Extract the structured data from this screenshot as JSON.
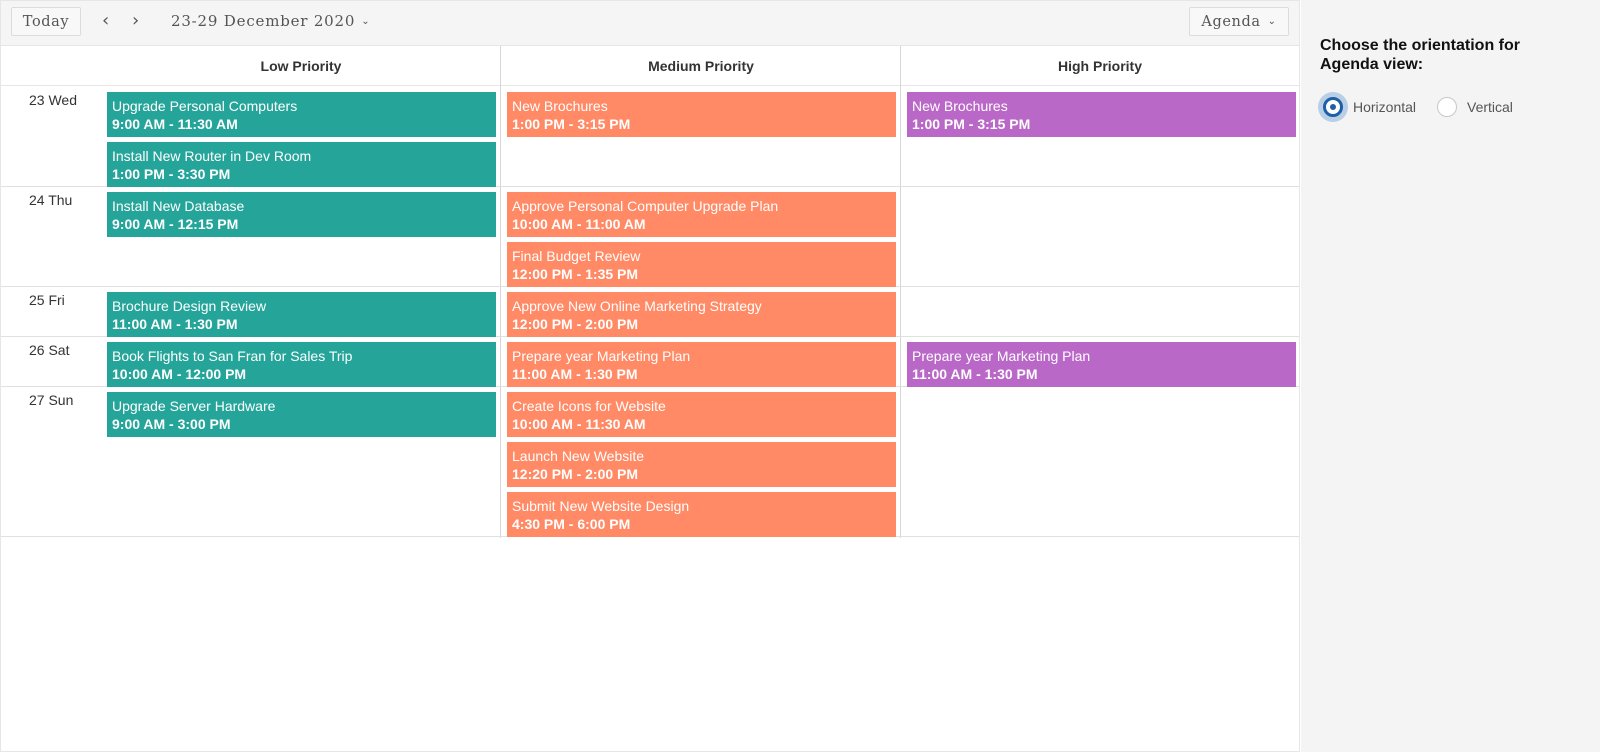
{
  "toolbar": {
    "today_label": "Today",
    "prev_icon": "‹",
    "next_icon": "›",
    "date_range": "23-29 December 2020",
    "view_label": "Agenda",
    "chevron_icon": "⌄"
  },
  "resources": [
    {
      "name": "Low Priority",
      "color": "#25a59a"
    },
    {
      "name": "Medium Priority",
      "color": "#ff8a65"
    },
    {
      "name": "High Priority",
      "color": "#ba68c8"
    }
  ],
  "days": [
    {
      "label": "23 Wed"
    },
    {
      "label": "24 Thu"
    },
    {
      "label": "25 Fri"
    },
    {
      "label": "26 Sat"
    },
    {
      "label": "27 Sun"
    }
  ],
  "events": [
    {
      "day": 0,
      "resource": 0,
      "title": "Upgrade Personal Computers",
      "time": "9:00 AM - 11:30 AM"
    },
    {
      "day": 0,
      "resource": 0,
      "title": "Install New Router in Dev Room",
      "time": "1:00 PM - 3:30 PM"
    },
    {
      "day": 0,
      "resource": 1,
      "title": "New Brochures",
      "time": "1:00 PM - 3:15 PM"
    },
    {
      "day": 0,
      "resource": 2,
      "title": "New Brochures",
      "time": "1:00 PM - 3:15 PM"
    },
    {
      "day": 1,
      "resource": 0,
      "title": "Install New Database",
      "time": "9:00 AM - 12:15 PM"
    },
    {
      "day": 1,
      "resource": 1,
      "title": "Approve Personal Computer Upgrade Plan",
      "time": "10:00 AM - 11:00 AM"
    },
    {
      "day": 1,
      "resource": 1,
      "title": "Final Budget Review",
      "time": "12:00 PM - 1:35 PM"
    },
    {
      "day": 2,
      "resource": 0,
      "title": "Brochure Design Review",
      "time": "11:00 AM - 1:30 PM"
    },
    {
      "day": 2,
      "resource": 1,
      "title": "Approve New Online Marketing Strategy",
      "time": "12:00 PM - 2:00 PM"
    },
    {
      "day": 3,
      "resource": 0,
      "title": "Book Flights to San Fran for Sales Trip",
      "time": "10:00 AM - 12:00 PM"
    },
    {
      "day": 3,
      "resource": 1,
      "title": "Prepare year Marketing Plan",
      "time": "11:00 AM - 1:30 PM"
    },
    {
      "day": 3,
      "resource": 2,
      "title": "Prepare year Marketing Plan",
      "time": "11:00 AM - 1:30 PM"
    },
    {
      "day": 4,
      "resource": 0,
      "title": "Upgrade Server Hardware",
      "time": "9:00 AM - 3:00 PM"
    },
    {
      "day": 4,
      "resource": 1,
      "title": "Create Icons for Website",
      "time": "10:00 AM - 11:30 AM"
    },
    {
      "day": 4,
      "resource": 1,
      "title": "Launch New Website",
      "time": "12:20 PM - 2:00 PM"
    },
    {
      "day": 4,
      "resource": 1,
      "title": "Submit New Website Design",
      "time": "4:30 PM - 6:00 PM"
    }
  ],
  "side_panel": {
    "title": "Choose the orientation for Agenda view:",
    "options": [
      {
        "label": "Horizontal",
        "selected": true
      },
      {
        "label": "Vertical",
        "selected": false
      }
    ]
  }
}
